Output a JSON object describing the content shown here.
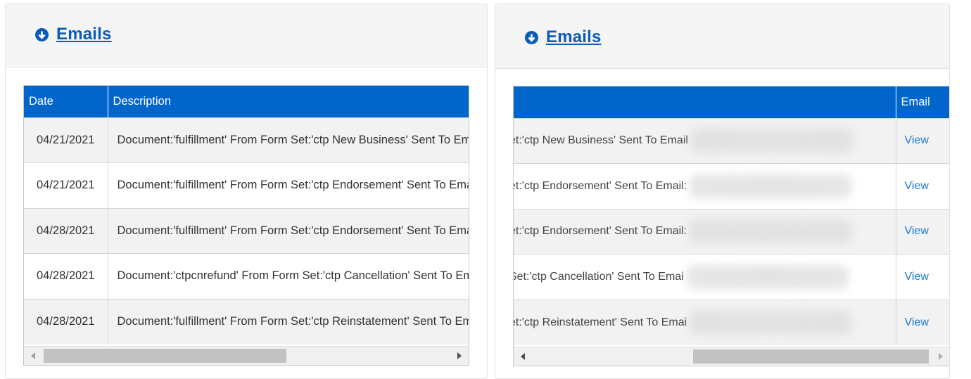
{
  "left_panel": {
    "title": "Emails",
    "icon": "arrow-circle-down-icon",
    "columns": [
      "Date",
      "Description"
    ],
    "rows": [
      {
        "date": "04/21/2021",
        "description": "Document:'fulfillment' From Form Set:'ctp New Business' Sent To Email"
      },
      {
        "date": "04/21/2021",
        "description": "Document:'fulfillment' From Form Set:'ctp Endorsement' Sent To Email:"
      },
      {
        "date": "04/28/2021",
        "description": "Document:'fulfillment' From Form Set:'ctp Endorsement' Sent To Email:"
      },
      {
        "date": "04/28/2021",
        "description": "Document:'ctpcnrefund' From Form Set:'ctp Cancellation' Sent To Email"
      },
      {
        "date": "04/28/2021",
        "description": "Document:'fulfillment' From Form Set:'ctp Reinstatement' Sent To Email"
      }
    ]
  },
  "right_panel": {
    "title": "Emails",
    "icon": "arrow-circle-down-icon",
    "columns": [
      "",
      "Email"
    ],
    "rows": [
      {
        "description": "et:'ctp New Business' Sent To Email",
        "email_link": "View"
      },
      {
        "description": "et:'ctp Endorsement' Sent To Email:",
        "email_link": "View"
      },
      {
        "description": "et:'ctp Endorsement' Sent To Email:",
        "email_link": "View"
      },
      {
        "description": "Set:'ctp Cancellation' Sent To Emai",
        "email_link": "View"
      },
      {
        "description": "et:'ctp Reinstatement' Sent To Emai",
        "email_link": "View"
      }
    ]
  },
  "colors": {
    "header_blue": "#0066cc",
    "link_blue": "#0b5cb8",
    "row_alt": "#f2f2f2"
  }
}
